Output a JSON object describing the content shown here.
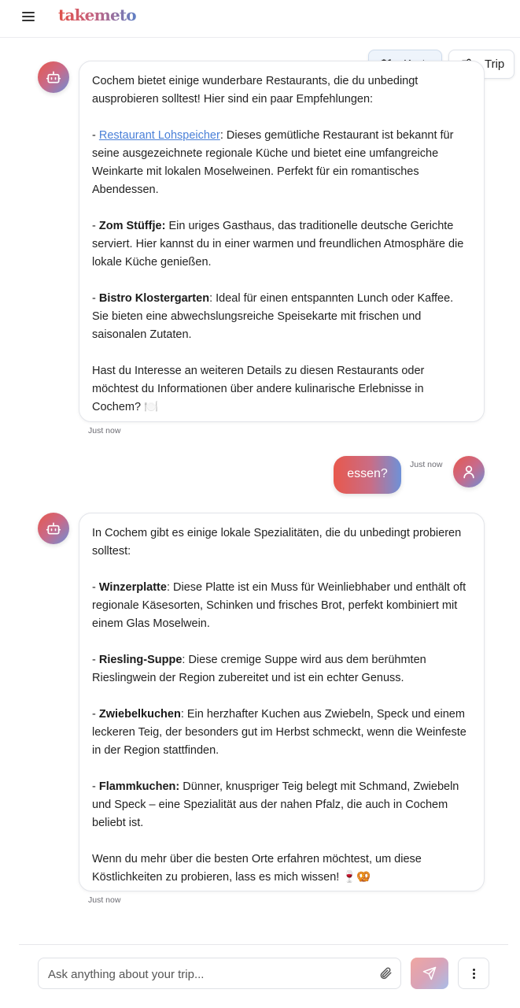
{
  "header": {
    "logo_text": "takemeto",
    "menu_icon": "hamburger-menu-icon"
  },
  "view_toggles": {
    "karte_label": "Karte",
    "karte_icon": "map-icon",
    "trip_label": "Trip",
    "trip_icon": "route-icon"
  },
  "messages": [
    {
      "role": "assistant",
      "avatar_icon": "bot-icon",
      "intro": "Cochem bietet einige wunderbare Restaurants, die du unbedingt ausprobieren solltest! Hier sind ein paar Empfehlungen:",
      "items": [
        {
          "prefix": "- ",
          "name": "Restaurant Lohspeicher",
          "is_link": true,
          "text": ": Dieses gemütliche Restaurant ist bekannt für seine ausgezeichnete regionale Küche und bietet eine umfangreiche Weinkarte mit lokalen Moselweinen. Perfekt für ein romantisches Abendessen."
        },
        {
          "prefix": "- ",
          "name": "Zom Stüffje:",
          "is_link": false,
          "text": " Ein uriges Gasthaus, das traditionelle deutsche Gerichte serviert. Hier kannst du in einer warmen und freundlichen Atmosphäre die lokale Küche genießen."
        },
        {
          "prefix": "- ",
          "name": "Bistro Klostergarten",
          "is_link": false,
          "text": ": Ideal für einen entspannten Lunch oder Kaffee. Sie bieten eine abwechslungsreiche Speisekarte mit frischen und saisonalen Zutaten."
        }
      ],
      "outro": "Hast du Interesse an weiteren Details zu diesen Restaurants oder möchtest du Informationen über andere kulinarische Erlebnisse in Cochem? 🍽️",
      "timestamp": "Just now"
    },
    {
      "role": "user",
      "avatar_icon": "user-icon",
      "text": "essen?",
      "timestamp": "Just now"
    },
    {
      "role": "assistant",
      "avatar_icon": "bot-icon",
      "intro": "In Cochem gibt es einige lokale Spezialitäten, die du unbedingt probieren solltest:",
      "items": [
        {
          "prefix": "- ",
          "name": "Winzerplatte",
          "is_link": false,
          "text": ": Diese Platte ist ein Muss für Weinliebhaber und enthält oft regionale Käsesorten, Schinken und frisches Brot, perfekt kombiniert mit einem Glas Moselwein."
        },
        {
          "prefix": "- ",
          "name": "Riesling-Suppe",
          "is_link": false,
          "text": ": Diese cremige Suppe wird aus dem berühmten Rieslingwein der Region zubereitet und ist ein echter Genuss."
        },
        {
          "prefix": "- ",
          "name": "Zwiebelkuchen",
          "is_link": false,
          "text": ": Ein herzhafter Kuchen aus Zwiebeln, Speck und einem leckeren Teig, der besonders gut im Herbst schmeckt, wenn die Weinfeste in der Region stattfinden."
        },
        {
          "prefix": "- ",
          "name": "Flammkuchen:",
          "is_link": false,
          "text": " Dünner, knuspriger Teig belegt mit Schmand, Zwiebeln und Speck – eine Spezialität aus der nahen Pfalz, die auch in Cochem beliebt ist."
        }
      ],
      "outro": "Wenn du mehr über die besten Orte erfahren möchtest, um diese Köstlichkeiten zu probieren, lass es mich wissen! 🍷🥨",
      "timestamp": "Just now"
    }
  ],
  "composer": {
    "placeholder": "Ask anything about your trip...",
    "value": "",
    "attach_icon": "paperclip-icon",
    "send_icon": "send-icon",
    "more_icon": "more-vertical-icon"
  },
  "colors": {
    "accent_start": "#e8584c",
    "accent_mid": "#c96d86",
    "accent_end": "#6e91d8",
    "link": "#4a80d8"
  }
}
